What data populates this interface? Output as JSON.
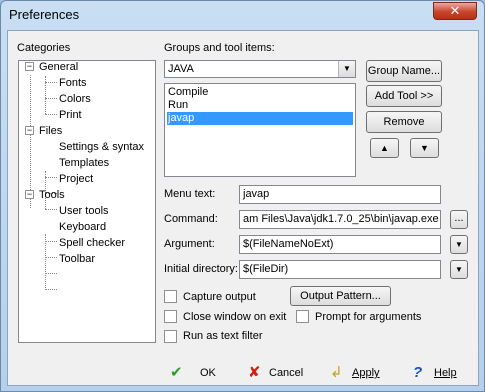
{
  "window": {
    "title": "Preferences",
    "close_glyph": "✕"
  },
  "categories": {
    "heading": "Categories",
    "tree": [
      {
        "label": "General",
        "expander": "−"
      },
      {
        "label": "Fonts"
      },
      {
        "label": "Colors"
      },
      {
        "label": "Print"
      },
      {
        "label": "Files",
        "expander": "−"
      },
      {
        "label": "Settings & syntax"
      },
      {
        "label": "Templates"
      },
      {
        "label": "Project"
      },
      {
        "label": "Tools",
        "expander": "−"
      },
      {
        "label": "User tools"
      },
      {
        "label": "Keyboard"
      },
      {
        "label": "Spell checker"
      },
      {
        "label": "Toolbar"
      }
    ]
  },
  "groups": {
    "heading": "Groups and tool items:",
    "selected_group": "JAVA",
    "items": [
      "Compile",
      "Run",
      "javap"
    ],
    "selected_item": "javap",
    "buttons": {
      "group_name": "Group Name...",
      "add_tool": "Add Tool >>",
      "remove": "Remove",
      "up": "▲",
      "down": "▼"
    }
  },
  "fields": {
    "menu_text": {
      "label": "Menu text:",
      "value": "javap"
    },
    "command": {
      "label": "Command:",
      "value": "am Files\\Java\\jdk1.7.0_25\\bin\\javap.exe",
      "browse": "..."
    },
    "argument": {
      "label": "Argument:",
      "value": "$(FileNameNoExt)"
    },
    "initial_directory": {
      "label": "Initial directory:",
      "value": "$(FileDir)"
    }
  },
  "options": {
    "capture_output": "Capture output",
    "output_pattern": "Output Pattern...",
    "close_window": "Close window on exit",
    "prompt_arguments": "Prompt for arguments",
    "run_as_filter": "Run as text filter"
  },
  "footer": {
    "ok": "OK",
    "cancel": "Cancel",
    "apply": "Apply",
    "help": "Help"
  },
  "colors": {
    "selection": "#3399ff",
    "ok_icon": "#2e9e2e",
    "cancel_icon": "#d02010",
    "apply_icon": "#c8a020",
    "help_icon": "#2050c0"
  }
}
